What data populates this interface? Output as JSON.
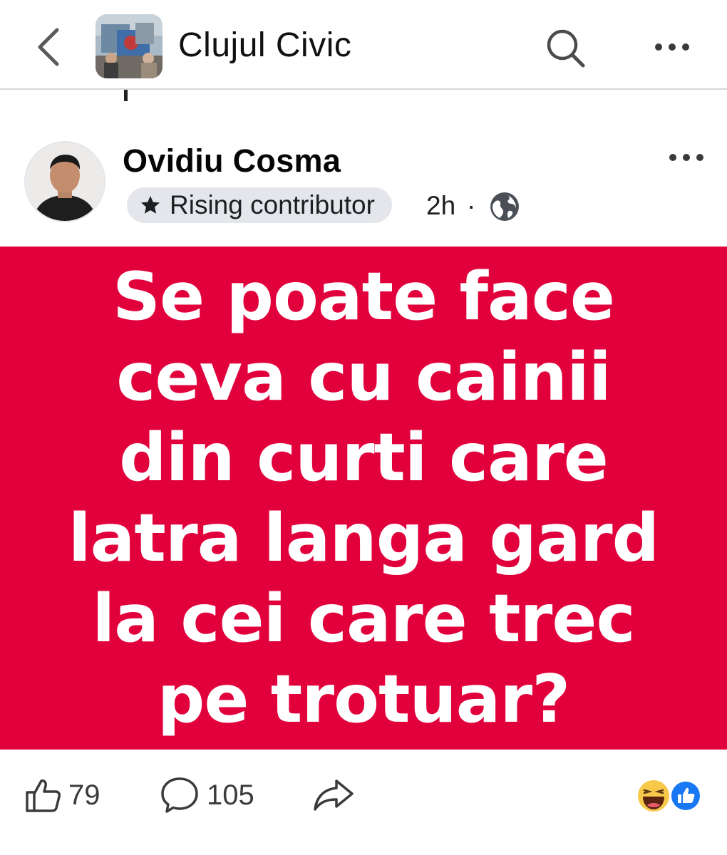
{
  "header": {
    "group_name": "Clujul Civic",
    "back_icon": "chevron-left-icon",
    "search_icon": "search-icon",
    "more_icon": "more-horizontal-icon"
  },
  "post": {
    "author": "Ovidiu Cosma",
    "badge": "Rising contributor",
    "badge_icon": "star-icon",
    "time": "2h",
    "separator": "·",
    "privacy_icon": "globe-icon",
    "background_color": "#e1003c",
    "text": "Se poate face ceva cu cainii din curti care latra langa gard la cei care trec pe trotuar?"
  },
  "footer": {
    "likes": "79",
    "comments": "105",
    "like_icon": "thumbs-up-icon",
    "comment_icon": "comment-icon",
    "share_icon": "share-icon",
    "reactions": [
      "haha",
      "like"
    ]
  }
}
